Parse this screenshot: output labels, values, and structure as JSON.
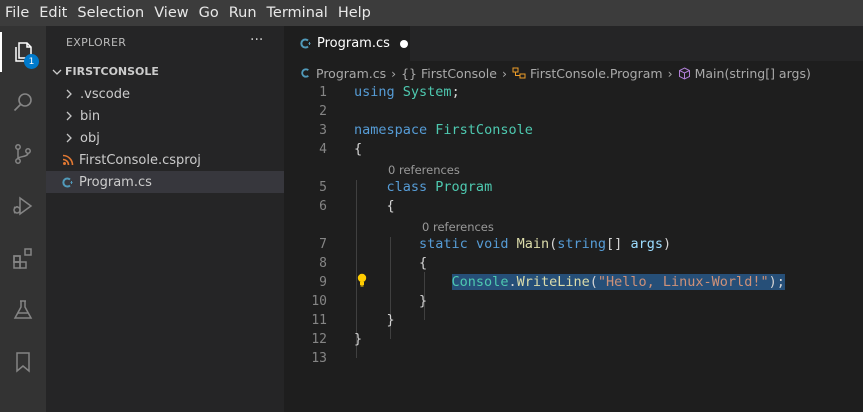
{
  "menu": [
    "File",
    "Edit",
    "Selection",
    "View",
    "Go",
    "Run",
    "Terminal",
    "Help"
  ],
  "activity_bar": {
    "explorer_badge": "1",
    "icons": [
      "files-icon",
      "search-icon",
      "source-control-icon",
      "run-debug-icon",
      "extensions-icon",
      "testing-icon",
      "bookmark-icon"
    ]
  },
  "sidebar": {
    "header": "EXPLORER",
    "more": "···",
    "section": "FIRSTCONSOLE",
    "items": [
      {
        "label": ".vscode",
        "type": "folder"
      },
      {
        "label": "bin",
        "type": "folder"
      },
      {
        "label": "obj",
        "type": "folder"
      },
      {
        "label": "FirstConsole.csproj",
        "type": "file",
        "icon": "rss-icon"
      },
      {
        "label": "Program.cs",
        "type": "file",
        "icon": "csharp-icon",
        "selected": true
      }
    ]
  },
  "tab": {
    "label": "Program.cs",
    "modified": true
  },
  "breadcrumb": {
    "file": "Program.cs",
    "namespace_glyph": "{}",
    "namespace": "FirstConsole",
    "class": "FirstConsole.Program",
    "method": "Main(string[] args)"
  },
  "codelens": {
    "class_refs": "0 references",
    "method_refs": "0 references"
  },
  "line_numbers": [
    "1",
    "2",
    "3",
    "4",
    "5",
    "6",
    "7",
    "8",
    "9",
    "10",
    "11",
    "12",
    "13"
  ],
  "code": {
    "l1_kw": "using",
    "l1_ns": "System",
    "l1_semi": ";",
    "l3_kw": "namespace",
    "l3_ns": "FirstConsole",
    "l4": "{",
    "l5_kw": "class",
    "l5_type": "Program",
    "l6": "{",
    "l7_static": "static",
    "l7_void": "void",
    "l7_fn": "Main",
    "l7_open": "(",
    "l7_string": "string",
    "l7_arr": "[] ",
    "l7_args": "args",
    "l7_close": ")",
    "l8": "{",
    "l9_cls": "Console",
    "l9_dot": ".",
    "l9_fn": "WriteLine",
    "l9_open": "(",
    "l9_str": "\"Hello, Linux-World!\"",
    "l9_close": ");",
    "l10": "}",
    "l11": "}",
    "l12": "}"
  },
  "colors": {
    "accent": "#007acc",
    "selection": "#264f78",
    "lightbulb": "#ffcc00"
  }
}
